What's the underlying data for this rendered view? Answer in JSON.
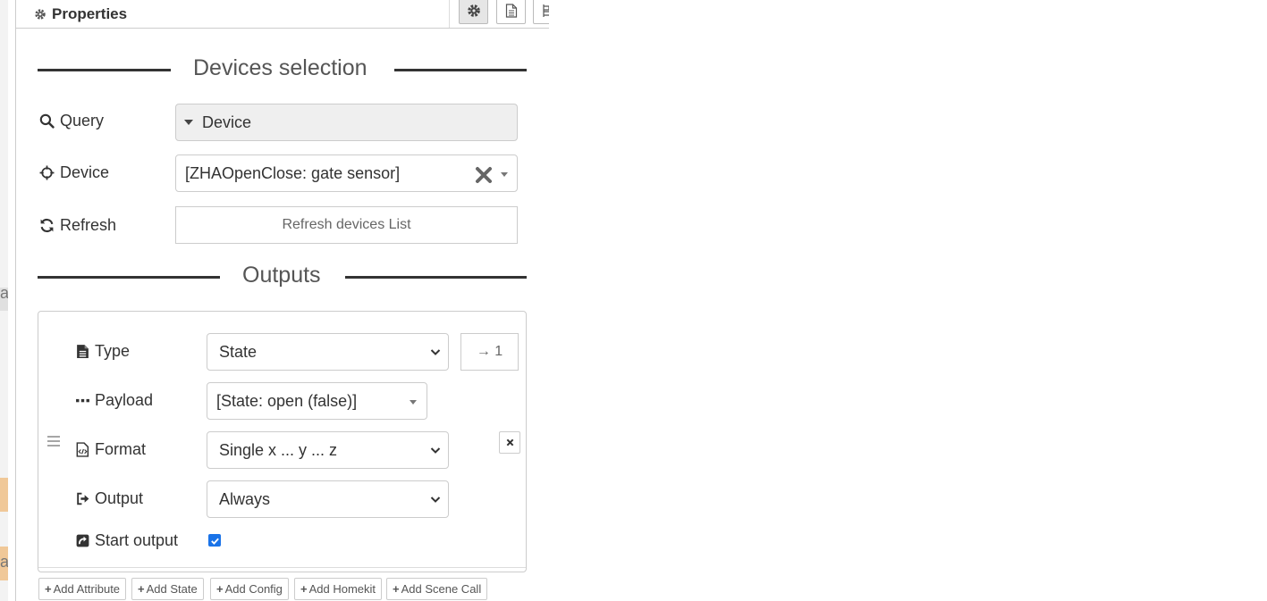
{
  "panel": {
    "title": "Properties"
  },
  "devices_section": {
    "heading": "Devices selection"
  },
  "query": {
    "label": "Query",
    "value": "Device"
  },
  "device": {
    "label": "Device",
    "value": "[ZHAOpenClose: gate sensor]"
  },
  "refresh": {
    "label": "Refresh",
    "button": "Refresh devices List"
  },
  "outputs_section": {
    "heading": "Outputs"
  },
  "output_item": {
    "type_label": "Type",
    "type_value": "State",
    "port": "→ 1",
    "payload_label": "Payload",
    "payload_value": "[State: open (false)]",
    "format_label": "Format",
    "format_value": "Single x ... y ... z",
    "output_label": "Output",
    "output_value": "Always",
    "start_output_label": "Start output",
    "start_output_checked": true
  },
  "add_buttons": [
    "Add Attribute",
    "Add State",
    "Add Config",
    "Add Homekit",
    "Add Scene Call"
  ],
  "background_text": {
    "left_letter_1": "a",
    "left_letter_2": "a"
  },
  "colors": {
    "accent_checkbox": "#1a73e8",
    "left_strip_tab": "#f0c898",
    "input_disabled_bg": "#efefef"
  }
}
